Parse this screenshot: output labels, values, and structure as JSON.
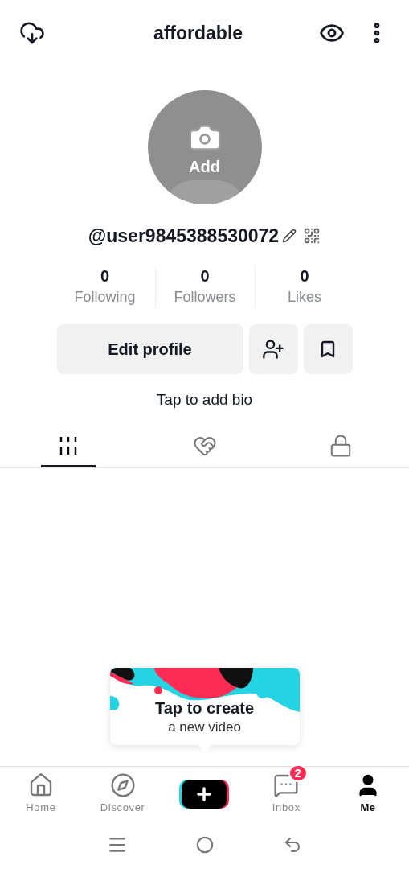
{
  "header": {
    "title": "affordable"
  },
  "avatar": {
    "label": "Add"
  },
  "username": "@user9845388530072",
  "stats": [
    {
      "value": "0",
      "label": "Following"
    },
    {
      "value": "0",
      "label": "Followers"
    },
    {
      "value": "0",
      "label": "Likes"
    }
  ],
  "edit_button": "Edit profile",
  "bio": "Tap to add bio",
  "content_tabs": [
    {
      "kind": "videos",
      "selected": true
    },
    {
      "kind": "liked",
      "selected": false
    },
    {
      "kind": "private",
      "selected": false
    }
  ],
  "tooltip": {
    "title": "Tap to create",
    "subtitle": "a new video"
  },
  "nav": [
    {
      "kind": "home",
      "label": "Home",
      "selected": false
    },
    {
      "kind": "discover",
      "label": "Discover",
      "selected": false
    },
    {
      "kind": "create",
      "selected": false
    },
    {
      "kind": "inbox",
      "label": "Inbox",
      "badge": "2",
      "selected": false
    },
    {
      "kind": "me",
      "label": "Me",
      "selected": true
    }
  ]
}
